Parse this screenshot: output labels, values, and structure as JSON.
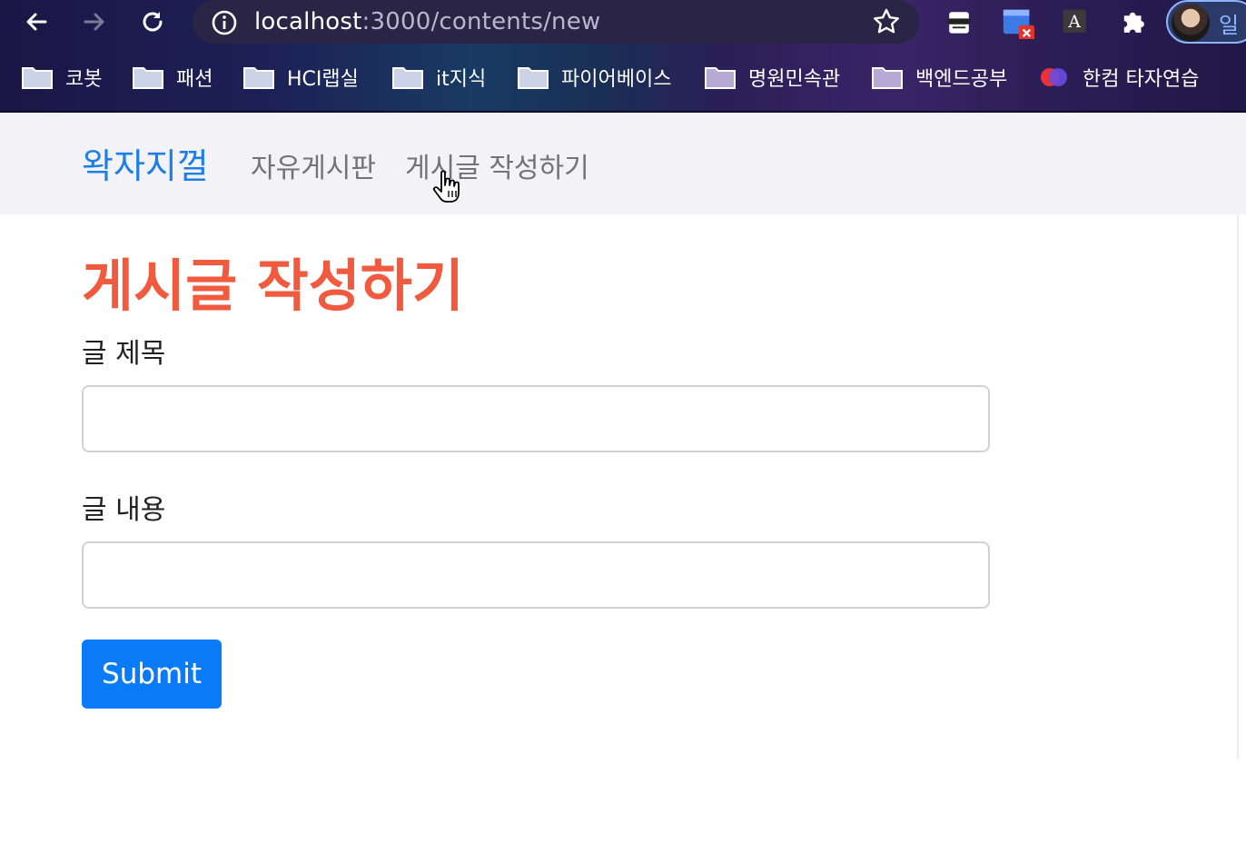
{
  "browser": {
    "url_host": "localhost",
    "url_rest": ":3000/contents/new",
    "profile_label": "일",
    "bookmarks": [
      {
        "label": "코봇",
        "icon": "folder-icon"
      },
      {
        "label": "패션",
        "icon": "folder-icon"
      },
      {
        "label": "HCI랩실",
        "icon": "folder-icon"
      },
      {
        "label": "it지식",
        "icon": "folder-icon"
      },
      {
        "label": "파이어베이스",
        "icon": "folder-icon"
      },
      {
        "label": "명원민속관",
        "icon": "folder-icon"
      },
      {
        "label": "백엔드공부",
        "icon": "folder-icon"
      },
      {
        "label": "한컴 타자연습",
        "icon": "hancom-icon"
      }
    ]
  },
  "navbar": {
    "brand": "왁자지껄",
    "links": [
      {
        "label": "자유게시판"
      },
      {
        "label": "게시글 작성하기"
      }
    ]
  },
  "form": {
    "title": "게시글 작성하기",
    "title_color": "#f05a3e",
    "fields": [
      {
        "label": "글 제목",
        "value": ""
      },
      {
        "label": "글 내용",
        "value": ""
      }
    ],
    "submit_label": "Submit",
    "submit_color": "#0a7bf7"
  }
}
